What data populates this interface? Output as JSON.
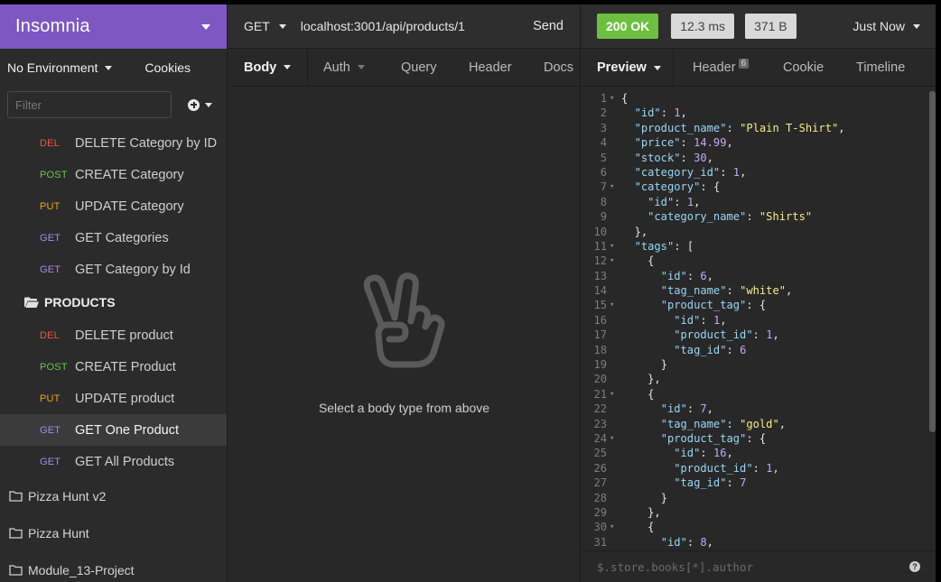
{
  "sidebar": {
    "brand": "Insomnia",
    "environment": "No Environment",
    "cookies": "Cookies",
    "filter_placeholder": "Filter",
    "requests_top": [
      {
        "method": "DEL",
        "name": "DELETE Category by ID"
      },
      {
        "method": "POST",
        "name": "CREATE Category"
      },
      {
        "method": "PUT",
        "name": "UPDATE Category"
      },
      {
        "method": "GET",
        "name": "GET Categories"
      },
      {
        "method": "GET",
        "name": "GET Category by Id"
      }
    ],
    "folder_products": "PRODUCTS",
    "requests_products": [
      {
        "method": "DEL",
        "name": "DELETE product"
      },
      {
        "method": "POST",
        "name": "CREATE Product"
      },
      {
        "method": "PUT",
        "name": "UPDATE product"
      },
      {
        "method": "GET",
        "name": "GET One Product",
        "active": true
      },
      {
        "method": "GET",
        "name": "GET All Products"
      }
    ],
    "workspaces": [
      "Pizza Hunt v2",
      "Pizza Hunt",
      "Module_13-Project"
    ]
  },
  "request": {
    "method": "GET",
    "url": "localhost:3001/api/products/1",
    "send_label": "Send",
    "tabs": [
      "Body",
      "Auth",
      "Query",
      "Header",
      "Docs"
    ],
    "empty_message": "Select a body type from above"
  },
  "response": {
    "status": "200 OK",
    "time": "12.3 ms",
    "size": "371 B",
    "when": "Just Now",
    "tabs": {
      "preview": "Preview",
      "header": "Header",
      "header_count": "6",
      "cookie": "Cookie",
      "timeline": "Timeline"
    },
    "filter_placeholder": "$.store.books[*].author",
    "help": "?",
    "lines": [
      "{",
      "  \"id\": 1,",
      "  \"product_name\": \"Plain T-Shirt\",",
      "  \"price\": 14.99,",
      "  \"stock\": 30,",
      "  \"category_id\": 1,",
      "  \"category\": {",
      "    \"id\": 1,",
      "    \"category_name\": \"Shirts\"",
      "  },",
      "  \"tags\": [",
      "    {",
      "      \"id\": 6,",
      "      \"tag_name\": \"white\",",
      "      \"product_tag\": {",
      "        \"id\": 1,",
      "        \"product_id\": 1,",
      "        \"tag_id\": 6",
      "      }",
      "    },",
      "    {",
      "      \"id\": 7,",
      "      \"tag_name\": \"gold\",",
      "      \"product_tag\": {",
      "        \"id\": 16,",
      "        \"product_id\": 1,",
      "        \"tag_id\": 7",
      "      }",
      "    },",
      "    {",
      "      \"id\": 8,"
    ],
    "fold_lines": [
      1,
      7,
      11,
      12,
      15,
      21,
      24,
      30
    ]
  },
  "colors": {
    "brand": "#7e57c2",
    "status_ok": "#6cbf3f",
    "DEL": "#e8584b",
    "POST": "#6fc34b",
    "PUT": "#f2a51c",
    "GET": "#a08df2"
  },
  "icons": {
    "peace": "peace-hand-icon",
    "folder_open": "folder-open-icon",
    "folder_closed": "folder-icon",
    "add": "plus-circle-icon",
    "help": "help-circle-icon"
  }
}
